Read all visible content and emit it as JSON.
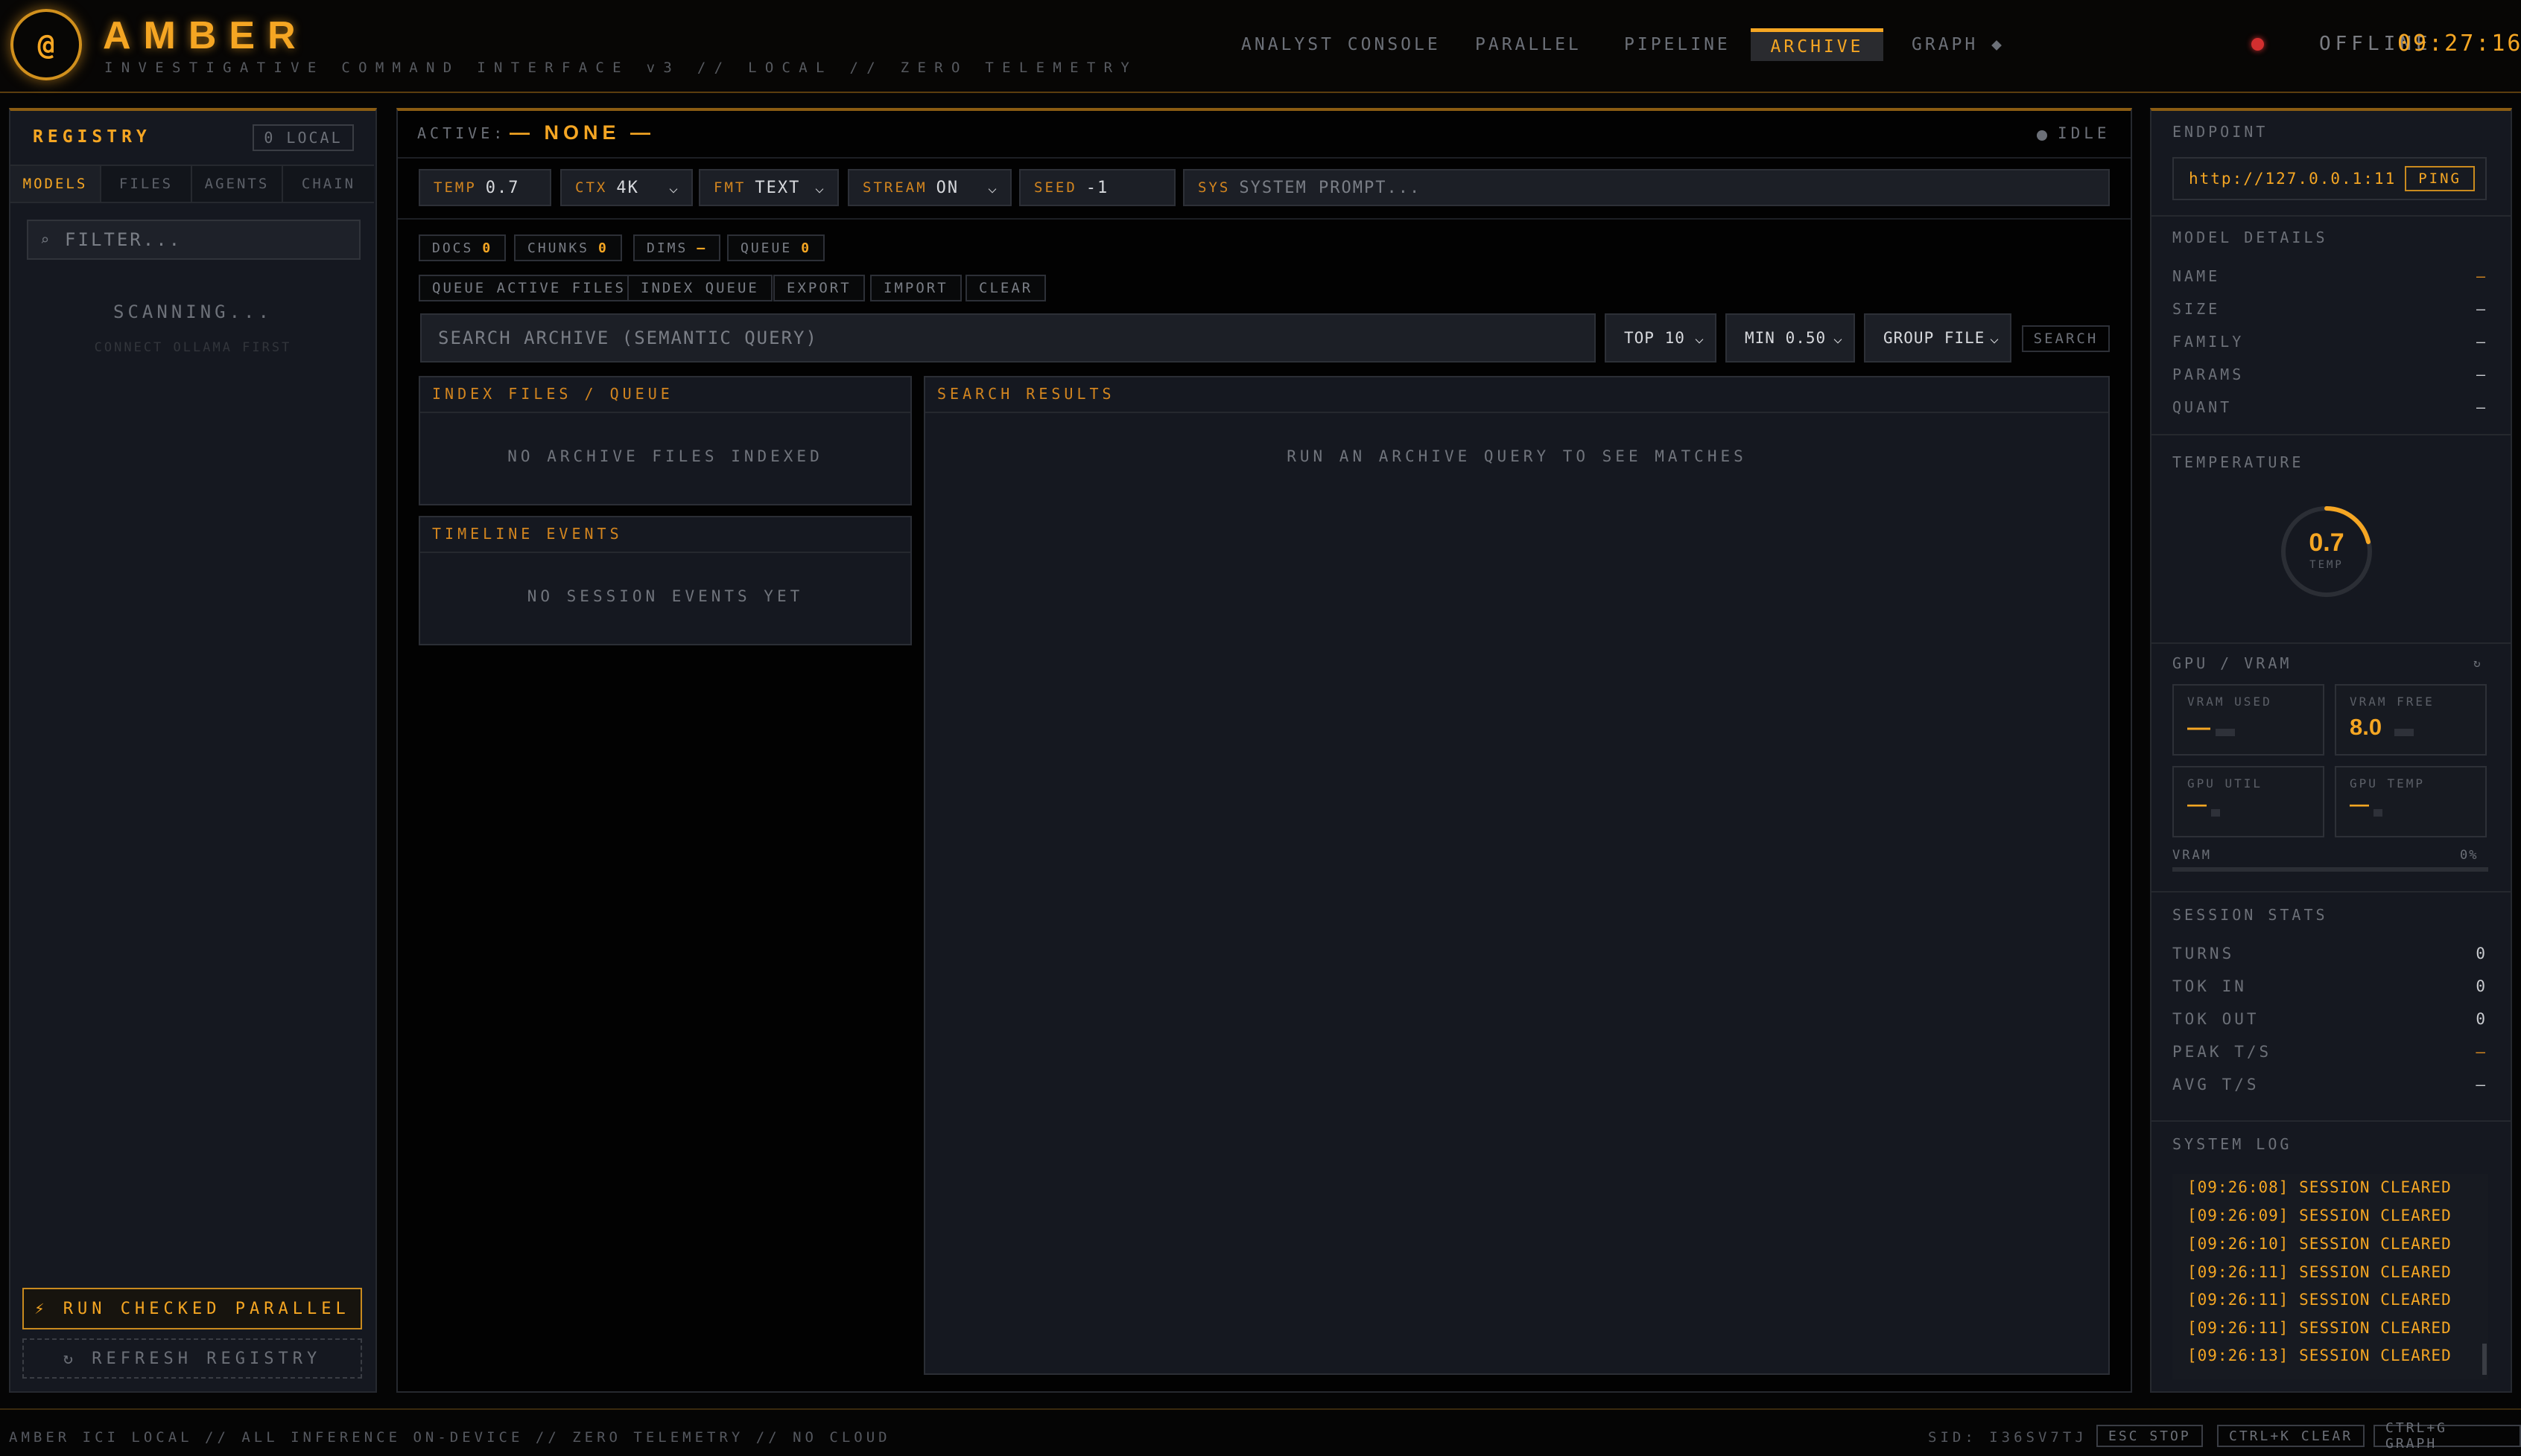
{
  "header": {
    "logo": "@",
    "title": "AMBER",
    "subtitle": "INVESTIGATIVE COMMAND INTERFACE v3 // LOCAL // ZERO TELEMETRY",
    "nav": [
      "ANALYST CONSOLE",
      "PARALLEL",
      "PIPELINE",
      "ARCHIVE",
      "GRAPH ◆"
    ],
    "active_nav": "ARCHIVE",
    "status": "OFFLINE",
    "clock": "09:27:16"
  },
  "registry": {
    "title": "REGISTRY",
    "local_badge": "0 LOCAL",
    "tabs": [
      "MODELS",
      "FILES",
      "AGENTS",
      "CHAIN"
    ],
    "filter_placeholder": "FILTER...",
    "scanning": "SCANNING...",
    "hint": "CONNECT OLLAMA FIRST",
    "run_button": "⚡ RUN CHECKED PARALLEL",
    "refresh_button": "↻ REFRESH REGISTRY"
  },
  "center": {
    "active_label": "ACTIVE:",
    "active_value": "— NONE —",
    "idle": "IDLE",
    "params": {
      "temp_key": "TEMP",
      "temp_val": "0.7",
      "ctx_key": "CTX",
      "ctx_val": "4K",
      "fmt_key": "FMT",
      "fmt_val": "TEXT",
      "stream_key": "STREAM",
      "stream_val": "ON",
      "seed_key": "SEED",
      "seed_val": "-1",
      "sys_key": "SYS",
      "sys_placeholder": "SYSTEM PROMPT..."
    },
    "stats": {
      "docs_label": "DOCS",
      "docs": "0",
      "chunks_label": "CHUNKS",
      "chunks": "0",
      "dims_label": "DIMS",
      "dims": "—",
      "queue_label": "QUEUE",
      "queue": "0"
    },
    "actions": [
      "QUEUE ACTIVE FILES",
      "INDEX QUEUE",
      "EXPORT",
      "IMPORT",
      "CLEAR"
    ],
    "search_placeholder": "SEARCH ARCHIVE (SEMANTIC QUERY)",
    "top": "TOP 10",
    "min": "MIN 0.50",
    "group": "GROUP FILE",
    "search_button": "SEARCH",
    "index_title": "INDEX FILES / QUEUE",
    "index_empty": "NO ARCHIVE FILES INDEXED",
    "timeline_title": "TIMELINE EVENTS",
    "timeline_empty": "NO SESSION EVENTS YET",
    "results_title": "SEARCH RESULTS",
    "results_empty": "RUN AN ARCHIVE QUERY TO SEE MATCHES"
  },
  "right": {
    "endpoint_label": "ENDPOINT",
    "endpoint": "http://127.0.0.1:11",
    "ping": "PING",
    "model_details_label": "MODEL DETAILS",
    "details": [
      {
        "k": "NAME",
        "v": "—"
      },
      {
        "k": "SIZE",
        "v": "—"
      },
      {
        "k": "FAMILY",
        "v": "—"
      },
      {
        "k": "PARAMS",
        "v": "—"
      },
      {
        "k": "QUANT",
        "v": "—"
      }
    ],
    "temperature_label": "TEMPERATURE",
    "temp_value": "0.7",
    "temp_unit": "TEMP",
    "gpu_label": "GPU / VRAM",
    "refresh_icon": "↻",
    "vram_used_label": "VRAM USED",
    "vram_used": "—",
    "vram_free_label": "VRAM FREE",
    "vram_free": "8.0",
    "gpu_util_label": "GPU UTIL",
    "gpu_util": "—",
    "gpu_temp_label": "GPU TEMP",
    "gpu_temp": "—",
    "vram_label": "VRAM",
    "vram_pct": "0%",
    "session_label": "SESSION STATS",
    "session": [
      {
        "k": "TURNS",
        "v": "0"
      },
      {
        "k": "TOK IN",
        "v": "0"
      },
      {
        "k": "TOK OUT",
        "v": "0"
      },
      {
        "k": "PEAK T/S",
        "v": "—"
      },
      {
        "k": "AVG T/S",
        "v": "—"
      }
    ],
    "log_label": "SYSTEM LOG",
    "log": [
      "[09:26:08] SESSION CLEARED",
      "[09:26:09] SESSION CLEARED",
      "[09:26:10] SESSION CLEARED",
      "[09:26:11] SESSION CLEARED",
      "[09:26:11] SESSION CLEARED",
      "[09:26:11] SESSION CLEARED",
      "[09:26:13] SESSION CLEARED"
    ]
  },
  "footer": {
    "text": "AMBER ICI LOCAL // ALL INFERENCE ON-DEVICE // ZERO TELEMETRY // NO CLOUD",
    "sid": "SID: I36SV7TJ",
    "shortcuts": [
      "ESC STOP",
      "CTRL+K CLEAR",
      "CTRL+G GRAPH"
    ]
  },
  "colors": {
    "accent": "#f5a623",
    "background": "#050505",
    "panel": "#151820",
    "offline": "#d32f2f"
  }
}
